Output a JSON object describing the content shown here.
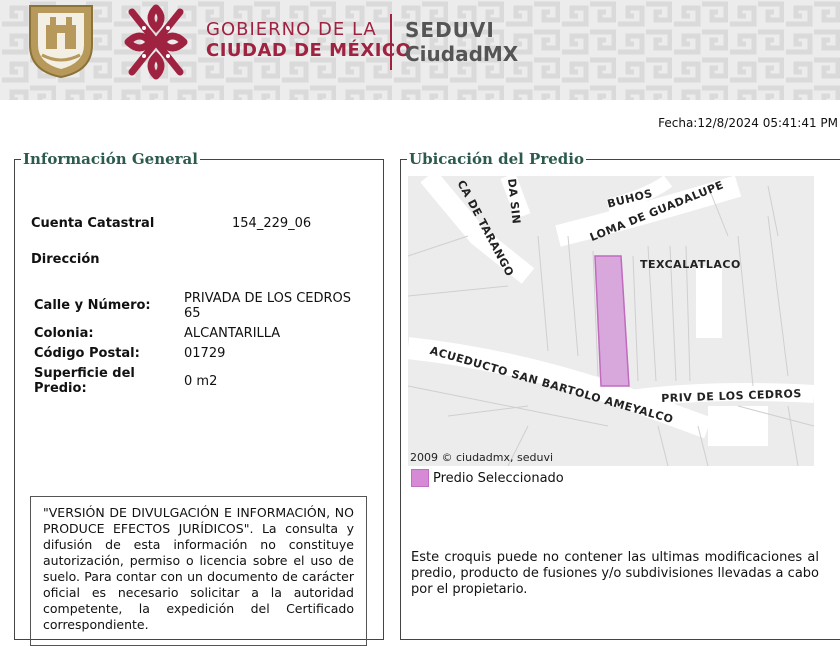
{
  "header": {
    "gov_line1": "GOBIERNO DE LA",
    "gov_line2": "CIUDAD DE MÉXICO",
    "agency_line1": "SEDUVI",
    "agency_line2": "CiudadMX",
    "brand_color": "#9f2241"
  },
  "fecha": "Fecha:12/8/2024 05:41:41 PM",
  "info": {
    "legend": "Información General",
    "cuenta_label": "Cuenta Catastral",
    "cuenta_value": "154_229_06",
    "direccion_label": "Dirección",
    "calle_label": "Calle y Número:",
    "calle_value_1": "PRIVADA DE LOS CEDROS",
    "calle_value_2": "65",
    "colonia_label": "Colonia:",
    "colonia_value": "ALCANTARILLA",
    "cp_label": "Código Postal:",
    "cp_value": "01729",
    "superficie_label_1": "Superficie del",
    "superficie_label_2": "Predio:",
    "superficie_value": "0 m2",
    "disclaimer": "\"VERSIÓN DE DIVULGACIÓN E INFORMACIÓN, NO PRODUCE EFECTOS JURÍDICOS\". La consulta y difusión de esta información no constituye autorización, permiso o licencia sobre el uso de suelo. Para contar con un documento de carácter oficial es necesario solicitar a la autoridad competente, la expedición del Certificado correspondiente."
  },
  "ubicacion": {
    "legend": "Ubicación del Predio",
    "map_labels": {
      "tarango": "CA DE TARANGO",
      "dasin": "DA SIN",
      "buhos": "BUHOS",
      "loma": "LOMA DE GUADALUPE",
      "texcalatlaco": "TEXCALATLACO",
      "acueducto": "ACUEDUCTO SAN BARTOLO AMEYALCO",
      "priv": "PRIV DE LOS CEDROS"
    },
    "credit": "2009 © ciudadmx, seduvi",
    "legend_item": "Predio Seleccionado",
    "highlight_color": "#d68ad6",
    "note": "Este croquis puede no contener las ultimas modificaciones al predio, producto de fusiones y/o subdivisiones llevadas a cabo por el propietario."
  }
}
